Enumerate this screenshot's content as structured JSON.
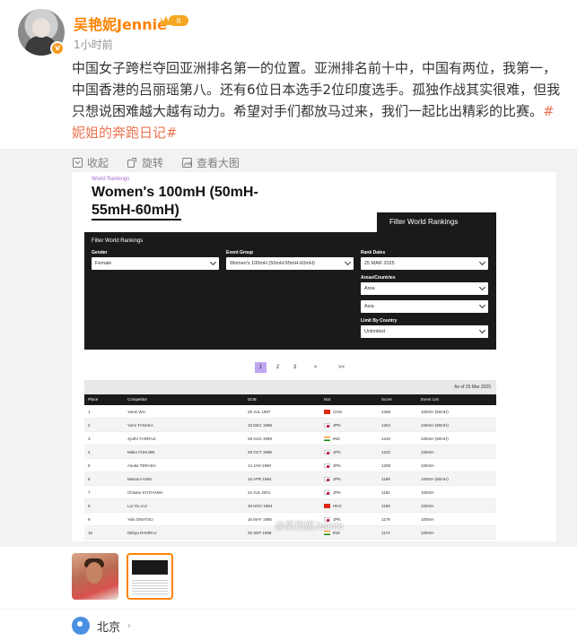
{
  "user": {
    "name": "吴艳妮Jennie",
    "badge_level": "II",
    "verified_mark": "v",
    "time": "1小时前"
  },
  "post": {
    "text": "中国女子跨栏夺回亚洲排名第一的位置。亚洲排名前十中，中国有两位，我第一，中国香港的吕丽瑶第八。还有6位日本选手2位印度选手。孤独作战其实很难，但我只想说困难越大越有动力。希望对手们都放马过来，我们一起比出精彩的比赛。",
    "hashtag": "#妮姐的奔跑日记#"
  },
  "toolbar": {
    "collect": "收起",
    "rotate": "旋转",
    "view_large": "查看大图"
  },
  "ranking": {
    "subtitle": "World Rankings",
    "title": "Women's 100mH (50mH-55mH-60mH)",
    "filter_tab": "Filter World Rankings",
    "filter_heading": "Filter World Rankings",
    "gender_label": "Gender",
    "gender_value": "Female",
    "event_label": "Event Group",
    "event_value": "Women's 100mH (50mH-55mH-60mH)",
    "rank_date_label": "Rank Dates",
    "rank_date_value": "25 MAR 2025",
    "areas_label": "Areas/Countries",
    "areas_value": "Area",
    "region_value": "Asia",
    "limit_label": "Limit By Country",
    "limit_value": "Unlimited",
    "pages": [
      "1",
      "2",
      "3",
      ">",
      ">>"
    ],
    "as_of": "As of 25 Mar 2025",
    "columns": [
      "Place",
      "Competitor",
      "DOB",
      "Nat",
      "Score",
      "Event List"
    ],
    "rows": [
      {
        "place": "1",
        "name": "Yanni WU",
        "dob": "28 JUL 1997",
        "nat": "CHN",
        "score": "1258",
        "event": "100mH (60mH)"
      },
      {
        "place": "2",
        "name": "Yumi TANAKA",
        "dob": "15 DEC 1998",
        "nat": "JPN",
        "score": "1254",
        "event": "100mH (60mH)"
      },
      {
        "place": "3",
        "name": "Jyothi YARRAJI",
        "dob": "28 AUG 1999",
        "nat": "IND",
        "score": "1240",
        "event": "100mH (60mH)"
      },
      {
        "place": "4",
        "name": "Mako FUKUBE",
        "dob": "28 OCT 1995",
        "nat": "JPN",
        "score": "1232",
        "event": "100mH"
      },
      {
        "place": "5",
        "name": "Asuka TERADA",
        "dob": "14 JAN 1990",
        "nat": "JPN",
        "score": "1208",
        "event": "100mH"
      },
      {
        "place": "6",
        "name": "Masumi AOKI",
        "dob": "16 APR 1994",
        "nat": "JPN",
        "score": "1199",
        "event": "100mH (60mH)"
      },
      {
        "place": "7",
        "name": "Chisato KIYOYAMA",
        "dob": "24 JUL 2001",
        "nat": "JPN",
        "score": "1182",
        "event": "100mH"
      },
      {
        "place": "8",
        "name": "Lui Yiu LUI",
        "dob": "30 NOV 1994",
        "nat": "HKG",
        "score": "1180",
        "event": "100mH"
      },
      {
        "place": "9",
        "name": "Yuki OMATSU",
        "dob": "16 MAY 1995",
        "nat": "JPN",
        "score": "1179",
        "event": "100mH"
      },
      {
        "place": "10",
        "name": "Nithya RAMRAJ",
        "dob": "20 SEP 1998",
        "nat": "IND",
        "score": "1174",
        "event": "100mH"
      }
    ]
  },
  "watermark": "@吴艳妮Jennie",
  "location": {
    "name": "北京",
    "arrow": "›"
  },
  "colors": {
    "brand_orange": "#ff8200",
    "hashtag": "#eb7350",
    "location_blue": "#4a90e2"
  }
}
